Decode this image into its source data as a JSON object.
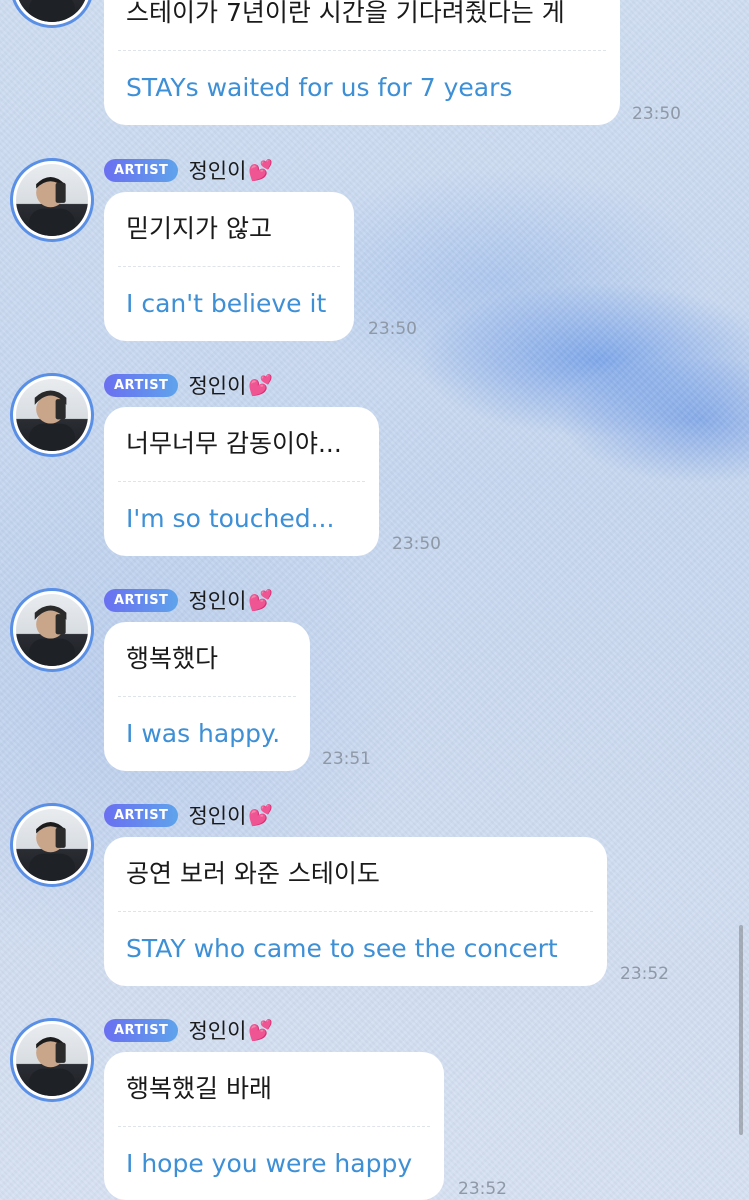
{
  "artist_badge": "ARTIST",
  "sender": "정인이",
  "heart_icon": "💕",
  "messages": [
    {
      "ko": "스테이가 7년이란 시간을 기다려줬다는 게",
      "en": "STAYs waited for us for 7 years",
      "time": "23:50"
    },
    {
      "ko": "믿기지가 않고",
      "en": "I can't believe it",
      "time": "23:50"
    },
    {
      "ko": "너무너무 감동이야...",
      "en": "I'm so touched...",
      "time": "23:50"
    },
    {
      "ko": "행복했다",
      "en": "I was happy.",
      "time": "23:51"
    },
    {
      "ko": "공연 보러 와준 스테이도",
      "en": "STAY who came to see the concert",
      "time": "23:52"
    },
    {
      "ko": "행복했길 바래",
      "en": "I hope you were happy",
      "time": "23:52"
    }
  ]
}
